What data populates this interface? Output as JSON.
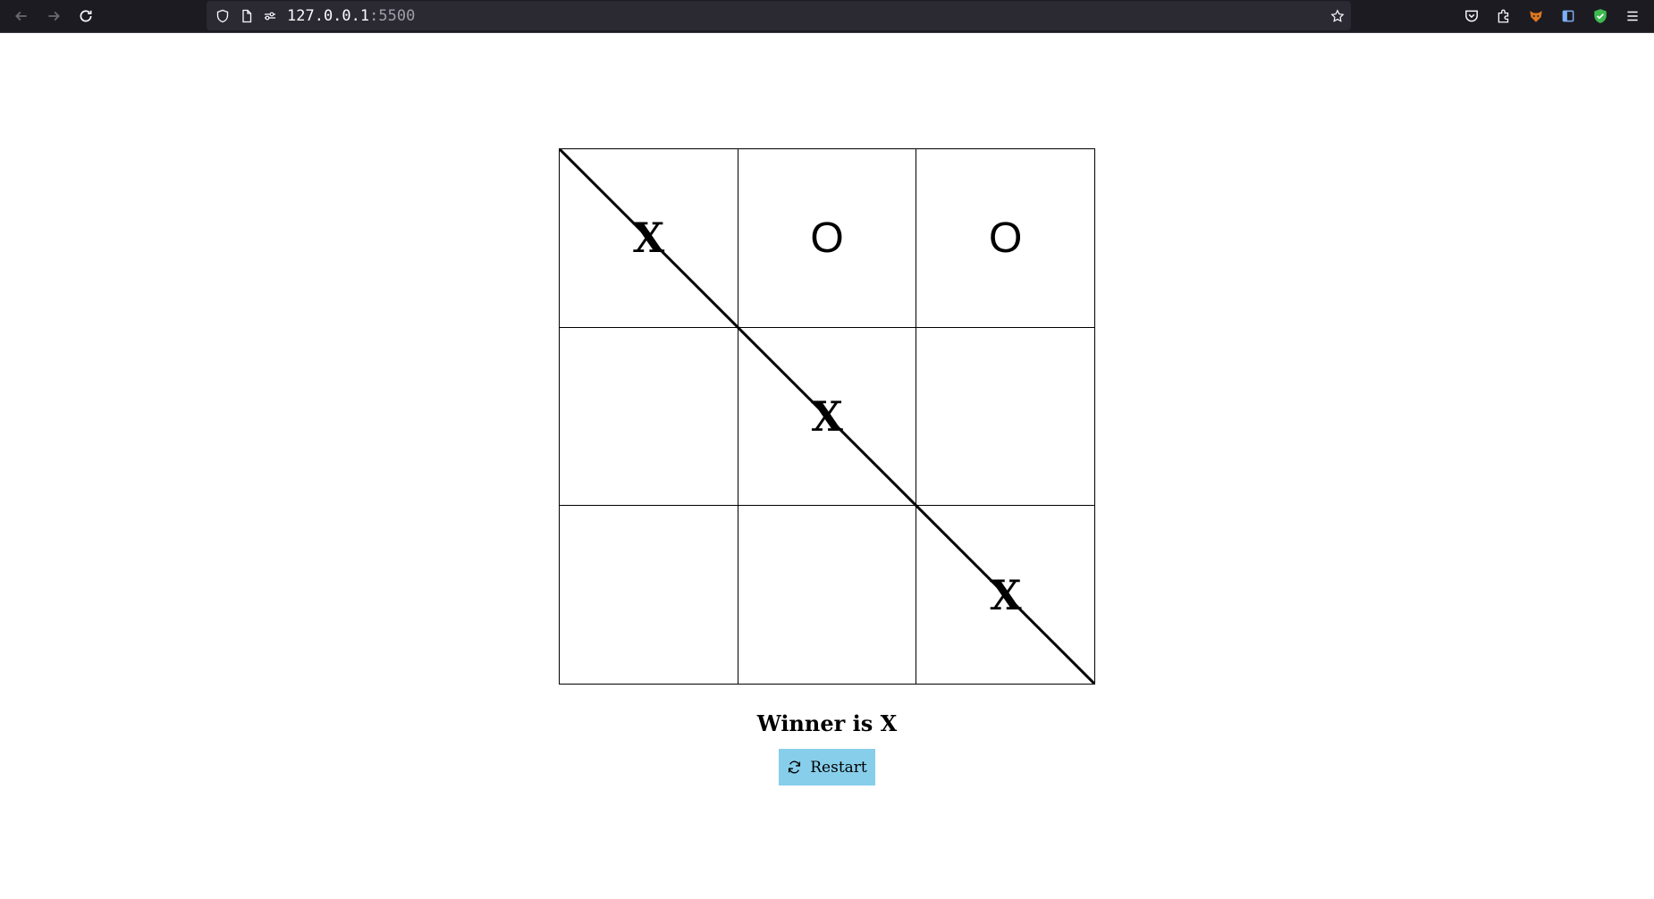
{
  "browser": {
    "url_host": "127.0.0.1",
    "url_port": ":5500",
    "icons": {
      "back": "back-arrow-icon",
      "forward": "forward-arrow-icon",
      "reload": "reload-icon",
      "shield": "tracking-protection-shield-icon",
      "page": "page-icon",
      "permissions": "permissions-icon",
      "bookmark": "bookmark-star-icon",
      "pocket": "pocket-icon",
      "extensions": "extensions-icon",
      "fox_extension": "fox-extension-icon",
      "sidebar": "sidebar-icon",
      "shield_check": "shield-check-extension-icon",
      "menu": "hamburger-menu-icon"
    }
  },
  "game": {
    "board": [
      [
        "X",
        "O",
        "O"
      ],
      [
        "",
        "X",
        ""
      ],
      [
        "",
        "",
        "X"
      ]
    ],
    "winning_line": "diagonal top-left to bottom-right",
    "status": "Winner is X",
    "restart_label": "Restart",
    "restart_icon": "refresh-icon",
    "restart_color": "#87ceeb"
  }
}
